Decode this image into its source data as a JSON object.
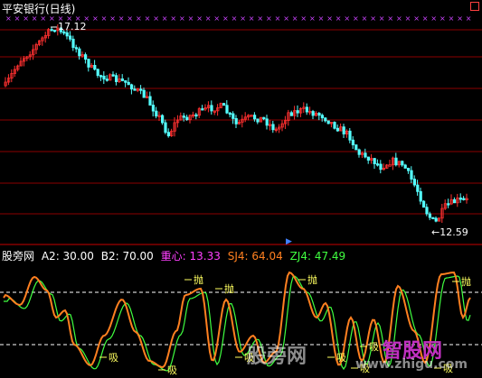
{
  "window": {
    "title": "平安银行(日线)"
  },
  "price_panel": {
    "high_label": "17.12",
    "low_label": "12.59",
    "colors": {
      "up": "#ff3030",
      "down": "#54ffff",
      "grid": "#8b0000",
      "frame": "#a00000"
    }
  },
  "indicator_panel": {
    "name": "股旁网",
    "params": [
      {
        "label": "A2: 30.00",
        "color": "#ffffff"
      },
      {
        "label": "B2: 70.00",
        "color": "#ffffff"
      }
    ],
    "series": [
      {
        "name": "重心:",
        "value": "13.33",
        "color": "#ff40ff",
        "value_color": "#ff40ff"
      },
      {
        "name": "SJ4:",
        "value": "64.04",
        "color": "#ff8020",
        "value_color": "#ff8020"
      },
      {
        "name": "ZJ4:",
        "value": "47.49",
        "color": "#40ff40",
        "value_color": "#40ff40"
      }
    ],
    "sell_signal": "抛",
    "buy_signal": "吸",
    "colors": {
      "sj4": "#ff8020",
      "zj4": "#40ff40",
      "level": "#ffffff",
      "signal": "#ffff60"
    }
  },
  "watermark": {
    "left_text": "股旁网",
    "right_text": "智股网",
    "url_text": "www.zhigu.com"
  }
}
